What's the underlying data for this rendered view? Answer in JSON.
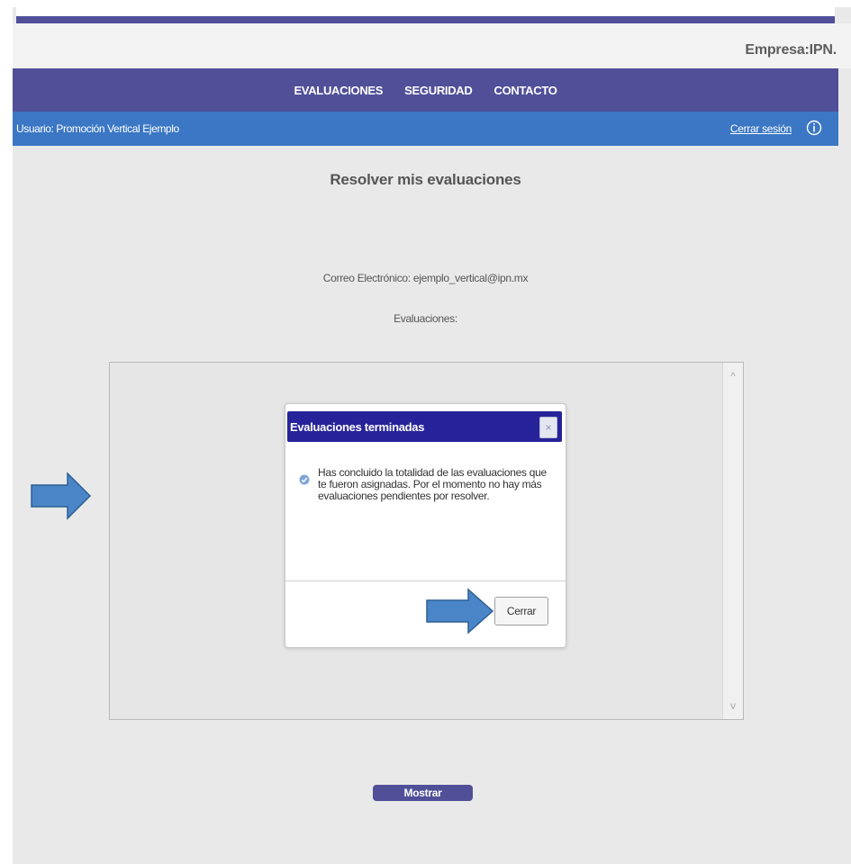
{
  "header": {
    "company": "Empresa:IPN."
  },
  "nav": {
    "items": [
      "EVALUACIONES",
      "SEGURIDAD",
      "CONTACTO"
    ]
  },
  "userbar": {
    "user_label": "Usuario: Promoción Vertical Ejemplo",
    "logout_label": "Cerrar sesión",
    "info_icon": "info-circle-icon"
  },
  "main": {
    "title": "Resolver mis evaluaciones",
    "email_line": "Correo Electrónico: ejemplo_vertical@ipn.mx",
    "evaluations_label": "Evaluaciones:",
    "show_button": "Mostrar"
  },
  "dialog": {
    "title": "Evaluaciones terminadas",
    "close_symbol": "×",
    "message": "Has concluido la totalidad de las evaluaciones que te fueron asignadas. Por el momento no hay más evaluaciones pendientes por resolver.",
    "button": "Cerrar"
  },
  "scrollbar": {
    "up": "^",
    "down": "v"
  },
  "colors": {
    "nav_bg": "#504f98",
    "userbar_bg": "#3b77c4",
    "dialog_header_bg": "#26239a",
    "annotation_arrow": "#4a86c7"
  }
}
